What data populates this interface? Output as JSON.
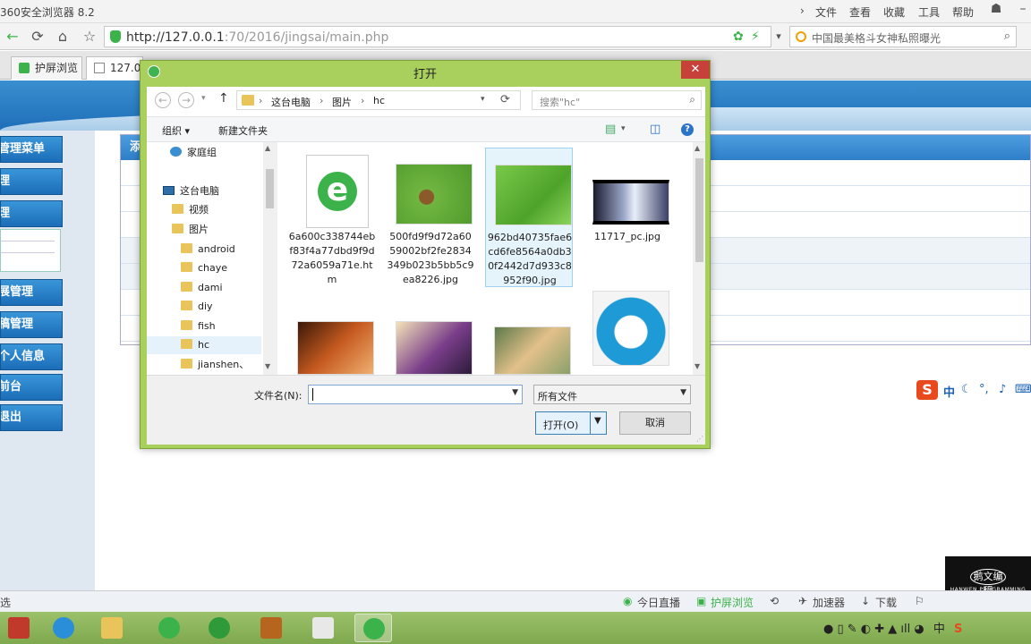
{
  "browser": {
    "app_title": "360安全浏览器 8.2",
    "menu": [
      "文件",
      "查看",
      "收藏",
      "工具",
      "帮助"
    ],
    "url_host": "http://127.0.0.1",
    "url_rest": ":70/2016/jingsai/main.php",
    "search_text": "中国最美格斗女神私照曝光",
    "tabs": [
      {
        "label": "护屏浏览"
      },
      {
        "label": "127.0.0"
      }
    ],
    "status_left": "选",
    "status_items": [
      "今日直播",
      "护屏浏览",
      "加速器",
      "下载"
    ]
  },
  "page": {
    "sidebar_buttons": [
      "管理菜单",
      "理",
      "理",
      "展管理",
      "稿管理",
      "个人信息",
      "前台",
      "退出"
    ],
    "content_header": "添"
  },
  "dialog": {
    "title": "打开",
    "close_symbol": "✕",
    "breadcrumb": [
      "这台电脑",
      "图片",
      "hc"
    ],
    "search_placeholder": "搜索\"hc\"",
    "toolbar": {
      "organize": "组织 ▾",
      "new_folder": "新建文件夹"
    },
    "tree": [
      {
        "label": "家庭组",
        "kind": "homegroup"
      },
      {
        "label": "这台电脑",
        "kind": "pc"
      },
      {
        "label": "视频",
        "kind": "folder"
      },
      {
        "label": "图片",
        "kind": "folder"
      },
      {
        "label": "android",
        "kind": "folder"
      },
      {
        "label": "chaye",
        "kind": "folder"
      },
      {
        "label": "dami",
        "kind": "folder"
      },
      {
        "label": "diy",
        "kind": "folder"
      },
      {
        "label": "fish",
        "kind": "folder"
      },
      {
        "label": "hc",
        "kind": "folder"
      },
      {
        "label": "jianshen、",
        "kind": "folder"
      }
    ],
    "files": [
      {
        "name": "6a600c338744ebf83f4a77dbd9f9d72a6059a71e.htm",
        "kind": "html"
      },
      {
        "name": "500fd9f9d72a6059002bf2fe2834349b023b5bb5c9ea8226.jpg",
        "kind": "bug"
      },
      {
        "name": "962bd40735fae6cd6fe8564a0db30f2442d7d933c8952f90.jpg",
        "kind": "leaf"
      },
      {
        "name": "11717_pc.jpg",
        "kind": "anime1"
      },
      {
        "name": "",
        "kind": "anime2"
      },
      {
        "name": "",
        "kind": "anime3"
      },
      {
        "name": "",
        "kind": "anime4"
      },
      {
        "name": "",
        "kind": "doraemon"
      }
    ],
    "filename_label": "文件名(N):",
    "filename_value": "",
    "filetype_value": "所有文件",
    "open_label": "打开(O)",
    "cancel_label": "取消"
  },
  "ime": {
    "badge": "S",
    "mode": "中"
  },
  "watermark": {
    "line1": "鹅文编程",
    "line2": "HANWEN PROGRAMMING"
  },
  "tray": {
    "ime": "中"
  },
  "colors": {
    "dialog_frame": "#a9cf5d",
    "taskbar": "#8fb65b",
    "sidebar_button": "#2a82c8"
  }
}
